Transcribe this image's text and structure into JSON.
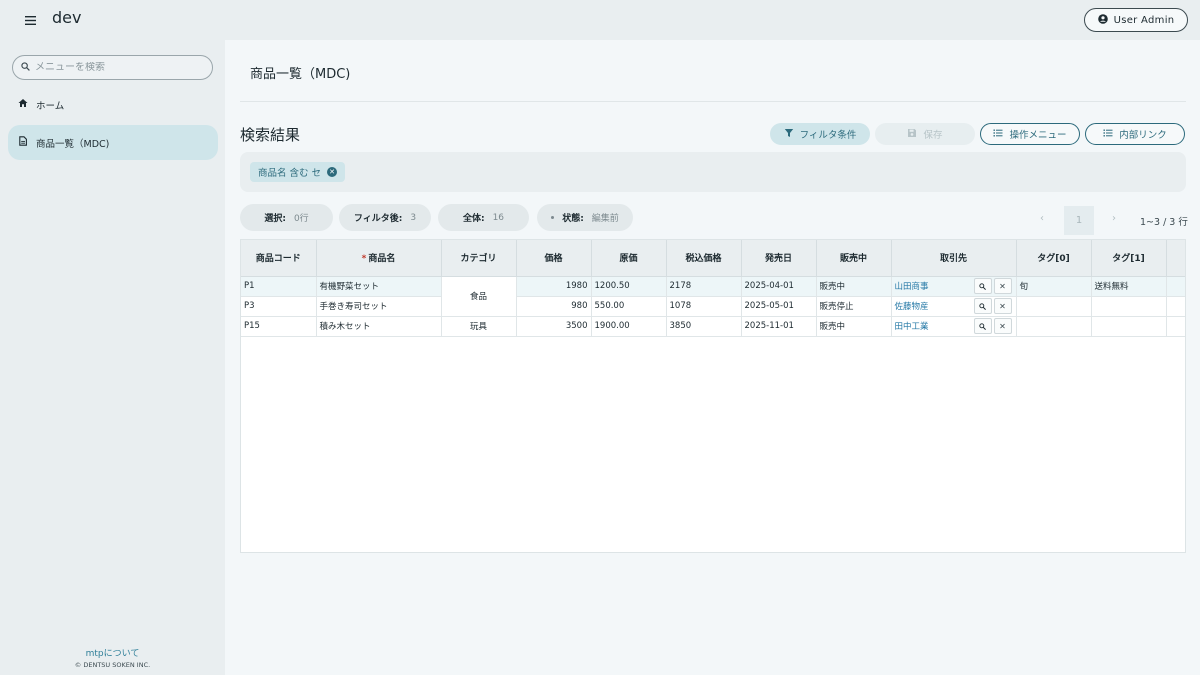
{
  "header": {
    "app_title": "dev",
    "user_label": "User Admin"
  },
  "sidebar": {
    "search_placeholder": "メニューを検索",
    "items": [
      {
        "label": "ホーム",
        "icon": "home-icon"
      },
      {
        "label": "商品一覧（MDC)",
        "icon": "document-icon",
        "active": true
      }
    ],
    "footer_link": "mtpについて",
    "copyright": "© DENTSU SOKEN INC."
  },
  "main": {
    "page_title": "商品一覧（MDC)",
    "section_title": "検索結果",
    "actions": {
      "filter": "フィルタ条件",
      "save": "保存",
      "operations": "操作メニュー",
      "internal_links": "内部リンク"
    },
    "filter_chip": "商品名 含む セ",
    "stats": {
      "selected_label": "選択:",
      "selected_value": "0行",
      "filtered_label": "フィルタ後:",
      "filtered_value": "3",
      "total_label": "全体:",
      "total_value": "16",
      "state_label": "状態:",
      "state_value": "編集前"
    },
    "pager": {
      "prev": "‹",
      "page": "1",
      "next": "›",
      "info": "1~3 / 3 行"
    },
    "table": {
      "columns": [
        "商品コード",
        "商品名",
        "カテゴリ",
        "価格",
        "原価",
        "税込価格",
        "発売日",
        "販売中",
        "取引先",
        "タグ[0]",
        "タグ[1]"
      ],
      "rows": [
        {
          "code": "P1",
          "name": "有機野菜セット",
          "price": "1980",
          "cost": "1200.50",
          "tax_price": "2178",
          "release": "2025-04-01",
          "status": "販売中",
          "partner": "山田商事",
          "tag0": "旬",
          "tag1": "送料無料"
        },
        {
          "code": "P3",
          "name": "手巻き寿司セット",
          "price": "980",
          "cost": "550.00",
          "tax_price": "1078",
          "release": "2025-05-01",
          "status": "販売停止",
          "partner": "佐藤物産",
          "tag0": "",
          "tag1": ""
        },
        {
          "code": "P15",
          "name": "積み木セット",
          "price": "3500",
          "cost": "1900.00",
          "tax_price": "3850",
          "release": "2025-11-01",
          "status": "販売中",
          "partner": "田中工業",
          "tag0": "",
          "tag1": ""
        }
      ],
      "categories": [
        {
          "label": "食品",
          "rows": 2
        },
        {
          "label": "玩具",
          "rows": 1
        }
      ]
    }
  },
  "colors": {
    "accent": "#2c6a7c",
    "link": "#2478a6",
    "active_nav": "#cfe5ea",
    "required": "#c0392b"
  }
}
